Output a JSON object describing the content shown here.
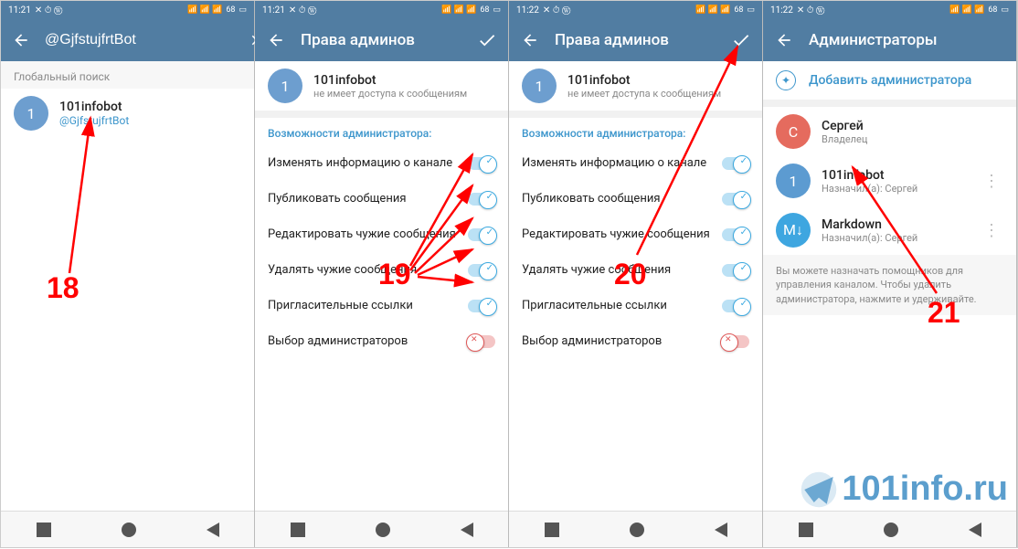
{
  "status": {
    "time1": "11:21",
    "time2": "11:21",
    "time3": "11:22",
    "time4": "11:22",
    "battery": "68"
  },
  "pane1": {
    "search_value": "@GjfstujfrtBot",
    "global_label": "Глобальный поиск",
    "result": {
      "title": "101infobot",
      "sub": "@GjfstujfrtBot",
      "avatar": "1"
    }
  },
  "pane2": {
    "title": "Права админов",
    "bot": {
      "title": "101infobot",
      "sub": "не имеет доступа к сообщениям",
      "avatar": "1"
    },
    "caps_label": "Возможности администратора:",
    "perms": [
      {
        "label": "Изменять информацию о канале",
        "on": true
      },
      {
        "label": "Публиковать сообщения",
        "on": true
      },
      {
        "label": "Редактировать чужие сообщения",
        "on": true
      },
      {
        "label": "Удалять чужие сообщения",
        "on": true
      },
      {
        "label": "Пригласительные ссылки",
        "on": true
      },
      {
        "label": "Выбор администраторов",
        "on": false
      }
    ]
  },
  "pane3": {
    "title": "Права админов",
    "bot": {
      "title": "101infobot",
      "sub": "не имеет доступа к сообщениям",
      "avatar": "1"
    },
    "caps_label": "Возможности администратора:",
    "perms": [
      {
        "label": "Изменять информацию о канале",
        "on": true
      },
      {
        "label": "Публиковать сообщения",
        "on": true
      },
      {
        "label": "Редактировать чужие сообщения",
        "on": true
      },
      {
        "label": "Удалять чужие сообщения",
        "on": true
      },
      {
        "label": "Пригласительные ссылки",
        "on": true
      },
      {
        "label": "Выбор администраторов",
        "on": false
      }
    ]
  },
  "pane4": {
    "title": "Администраторы",
    "add_label": "Добавить администратора",
    "admins": [
      {
        "avatar": "С",
        "title": "Сергей",
        "sub": "Владелец",
        "cls": "av-red",
        "more": false
      },
      {
        "avatar": "1",
        "title": "101infobot",
        "sub": "Назначил(а): Сергей",
        "cls": "av-lightblue",
        "more": true
      },
      {
        "avatar": "M↓",
        "title": "Markdown",
        "sub": "Назначил(а): Сергей",
        "cls": "av-teal",
        "more": true
      }
    ],
    "footer": "Вы можете назначать помощников для управления каналом. Чтобы удалить администратора, нажмите и удерживайте."
  },
  "annotations": {
    "n18": "18",
    "n19": "19",
    "n20": "20",
    "n21": "21"
  },
  "watermark": "101info.ru"
}
